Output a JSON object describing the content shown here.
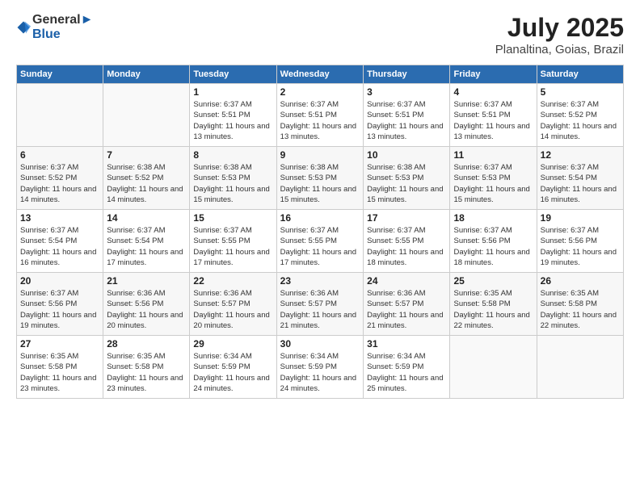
{
  "header": {
    "logo_line1": "General",
    "logo_line2": "Blue",
    "month": "July 2025",
    "location": "Planaltina, Goias, Brazil"
  },
  "days_of_week": [
    "Sunday",
    "Monday",
    "Tuesday",
    "Wednesday",
    "Thursday",
    "Friday",
    "Saturday"
  ],
  "weeks": [
    [
      {
        "day": "",
        "info": ""
      },
      {
        "day": "",
        "info": ""
      },
      {
        "day": "1",
        "info": "Sunrise: 6:37 AM\nSunset: 5:51 PM\nDaylight: 11 hours and 13 minutes."
      },
      {
        "day": "2",
        "info": "Sunrise: 6:37 AM\nSunset: 5:51 PM\nDaylight: 11 hours and 13 minutes."
      },
      {
        "day": "3",
        "info": "Sunrise: 6:37 AM\nSunset: 5:51 PM\nDaylight: 11 hours and 13 minutes."
      },
      {
        "day": "4",
        "info": "Sunrise: 6:37 AM\nSunset: 5:51 PM\nDaylight: 11 hours and 13 minutes."
      },
      {
        "day": "5",
        "info": "Sunrise: 6:37 AM\nSunset: 5:52 PM\nDaylight: 11 hours and 14 minutes."
      }
    ],
    [
      {
        "day": "6",
        "info": "Sunrise: 6:37 AM\nSunset: 5:52 PM\nDaylight: 11 hours and 14 minutes."
      },
      {
        "day": "7",
        "info": "Sunrise: 6:38 AM\nSunset: 5:52 PM\nDaylight: 11 hours and 14 minutes."
      },
      {
        "day": "8",
        "info": "Sunrise: 6:38 AM\nSunset: 5:53 PM\nDaylight: 11 hours and 15 minutes."
      },
      {
        "day": "9",
        "info": "Sunrise: 6:38 AM\nSunset: 5:53 PM\nDaylight: 11 hours and 15 minutes."
      },
      {
        "day": "10",
        "info": "Sunrise: 6:38 AM\nSunset: 5:53 PM\nDaylight: 11 hours and 15 minutes."
      },
      {
        "day": "11",
        "info": "Sunrise: 6:37 AM\nSunset: 5:53 PM\nDaylight: 11 hours and 15 minutes."
      },
      {
        "day": "12",
        "info": "Sunrise: 6:37 AM\nSunset: 5:54 PM\nDaylight: 11 hours and 16 minutes."
      }
    ],
    [
      {
        "day": "13",
        "info": "Sunrise: 6:37 AM\nSunset: 5:54 PM\nDaylight: 11 hours and 16 minutes."
      },
      {
        "day": "14",
        "info": "Sunrise: 6:37 AM\nSunset: 5:54 PM\nDaylight: 11 hours and 17 minutes."
      },
      {
        "day": "15",
        "info": "Sunrise: 6:37 AM\nSunset: 5:55 PM\nDaylight: 11 hours and 17 minutes."
      },
      {
        "day": "16",
        "info": "Sunrise: 6:37 AM\nSunset: 5:55 PM\nDaylight: 11 hours and 17 minutes."
      },
      {
        "day": "17",
        "info": "Sunrise: 6:37 AM\nSunset: 5:55 PM\nDaylight: 11 hours and 18 minutes."
      },
      {
        "day": "18",
        "info": "Sunrise: 6:37 AM\nSunset: 5:56 PM\nDaylight: 11 hours and 18 minutes."
      },
      {
        "day": "19",
        "info": "Sunrise: 6:37 AM\nSunset: 5:56 PM\nDaylight: 11 hours and 19 minutes."
      }
    ],
    [
      {
        "day": "20",
        "info": "Sunrise: 6:37 AM\nSunset: 5:56 PM\nDaylight: 11 hours and 19 minutes."
      },
      {
        "day": "21",
        "info": "Sunrise: 6:36 AM\nSunset: 5:56 PM\nDaylight: 11 hours and 20 minutes."
      },
      {
        "day": "22",
        "info": "Sunrise: 6:36 AM\nSunset: 5:57 PM\nDaylight: 11 hours and 20 minutes."
      },
      {
        "day": "23",
        "info": "Sunrise: 6:36 AM\nSunset: 5:57 PM\nDaylight: 11 hours and 21 minutes."
      },
      {
        "day": "24",
        "info": "Sunrise: 6:36 AM\nSunset: 5:57 PM\nDaylight: 11 hours and 21 minutes."
      },
      {
        "day": "25",
        "info": "Sunrise: 6:35 AM\nSunset: 5:58 PM\nDaylight: 11 hours and 22 minutes."
      },
      {
        "day": "26",
        "info": "Sunrise: 6:35 AM\nSunset: 5:58 PM\nDaylight: 11 hours and 22 minutes."
      }
    ],
    [
      {
        "day": "27",
        "info": "Sunrise: 6:35 AM\nSunset: 5:58 PM\nDaylight: 11 hours and 23 minutes."
      },
      {
        "day": "28",
        "info": "Sunrise: 6:35 AM\nSunset: 5:58 PM\nDaylight: 11 hours and 23 minutes."
      },
      {
        "day": "29",
        "info": "Sunrise: 6:34 AM\nSunset: 5:59 PM\nDaylight: 11 hours and 24 minutes."
      },
      {
        "day": "30",
        "info": "Sunrise: 6:34 AM\nSunset: 5:59 PM\nDaylight: 11 hours and 24 minutes."
      },
      {
        "day": "31",
        "info": "Sunrise: 6:34 AM\nSunset: 5:59 PM\nDaylight: 11 hours and 25 minutes."
      },
      {
        "day": "",
        "info": ""
      },
      {
        "day": "",
        "info": ""
      }
    ]
  ]
}
